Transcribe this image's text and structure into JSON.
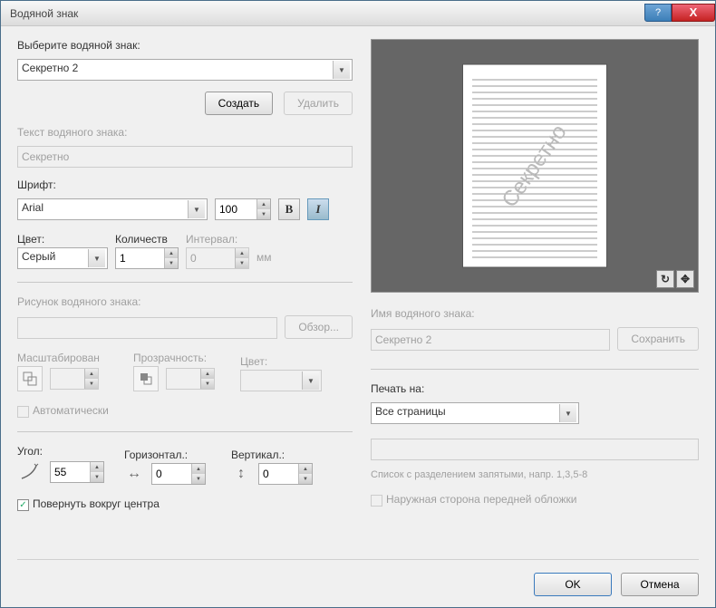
{
  "title": "Водяной знак",
  "select_label": "Выберите водяной знак:",
  "selected_watermark": "Секретно 2",
  "create_btn": "Создать",
  "delete_btn": "Удалить",
  "text_label": "Текст водяного знака:",
  "text_value": "Секретно",
  "font_label": "Шрифт:",
  "font_value": "Arial",
  "font_size": "100",
  "color_label": "Цвет:",
  "color_value": "Серый",
  "count_label": "Количеств",
  "count_value": "1",
  "interval_label": "Интервал:",
  "interval_value": "0",
  "interval_unit": "мм",
  "image_label": "Рисунок водяного знака:",
  "browse_btn": "Обзор...",
  "scale_label": "Масштабирован",
  "opacity_label": "Прозрачность:",
  "image_color_label": "Цвет:",
  "auto_label": "Автоматически",
  "angle_label": "Угол:",
  "angle_value": "55",
  "horiz_label": "Горизонтал.:",
  "horiz_value": "0",
  "vert_label": "Вертикал.:",
  "vert_value": "0",
  "rotate_center_label": "Повернуть вокруг центра",
  "name_label": "Имя водяного знака:",
  "name_value": "Секретно 2",
  "save_btn": "Сохранить",
  "print_on_label": "Печать на:",
  "print_on_value": "Все страницы",
  "list_hint": "Список с разделением запятыми, напр. 1,3,5-8",
  "front_cover_label": "Наружная сторона передней обложки",
  "ok_btn": "OK",
  "cancel_btn": "Отмена",
  "preview_watermark": "Секретно"
}
